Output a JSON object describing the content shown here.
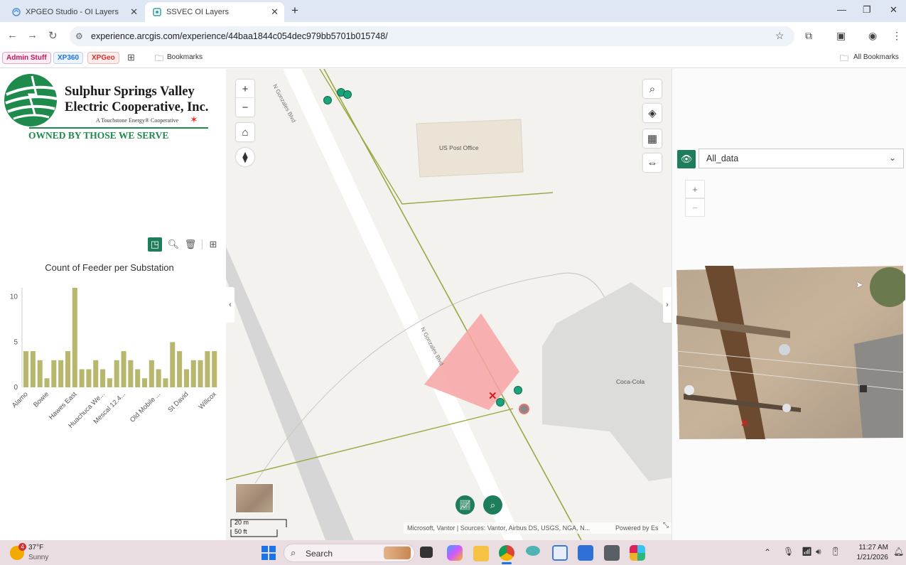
{
  "browser": {
    "tabs": [
      {
        "title": "XPGEO Studio - OI Layers",
        "active": false
      },
      {
        "title": "SSVEC OI Layers",
        "active": true
      }
    ],
    "new_tab": "+",
    "url": "experience.arcgis.com/experience/44baa1844c054dec979bb5701b015748/",
    "bookmarks": [
      {
        "label": "Admin Stuff",
        "color": "#c2185b"
      },
      {
        "label": "XP360",
        "color": "#1a73e8"
      },
      {
        "label": "XPGeo",
        "color": "#d93025"
      }
    ],
    "bookmarks_folder": "Bookmarks",
    "all_bookmarks": "All Bookmarks"
  },
  "logo": {
    "line1": "Sulphur Springs Valley",
    "line2": "Electric Cooperative, Inc.",
    "tagline": "A Touchstone Energy® Cooperative",
    "motto": "OWNED BY THOSE WE SERVE"
  },
  "chart_data": {
    "type": "bar",
    "title": "Count of Feeder per Substation",
    "categories": [
      "Alamo",
      "",
      "",
      "Bowie",
      "",
      "",
      "",
      "Hawes East",
      "",
      "",
      "",
      "Huachuca We...",
      "",
      "",
      "Mescal 12.4...",
      "",
      "",
      "",
      "",
      "Old Mobile ...",
      "",
      "",
      "",
      "St David",
      "",
      "",
      "",
      "Willcox"
    ],
    "values": [
      4,
      4,
      3,
      1,
      3,
      3,
      4,
      11,
      2,
      2,
      3,
      2,
      1,
      3,
      4,
      3,
      2,
      1,
      3,
      2,
      1,
      5,
      4,
      2,
      3,
      3,
      4,
      4
    ],
    "ylim": [
      0,
      11
    ],
    "yticks": [
      0,
      5,
      10
    ],
    "xtick_labels": [
      "Alamo",
      "Bowie",
      "Hawes East",
      "Huachuca We...",
      "Mescal 12.4...",
      "Old Mobile ...",
      "St David",
      "Willcox"
    ],
    "bar_color": "#b7b86e",
    "grid": false
  },
  "map": {
    "labels": {
      "post_office": "US Post Office",
      "street1": "N Gonzales Blvd",
      "street2": "N Gonzales Blvd",
      "cocacola": "Coca-Cola"
    },
    "scale_m": "20 m",
    "scale_ft": "50 ft",
    "attribution": "Microsoft, Vantor | Sources: Vantor, Airbus DS, USGS, NGA, N...",
    "powered_by": "Powered by Es",
    "controls": {
      "zoom_in": "+",
      "zoom_out": "−"
    }
  },
  "right_panel": {
    "layer_select": "All_data",
    "zoom_in": "+",
    "zoom_out": "−"
  },
  "taskbar": {
    "weather_temp": "37°F",
    "weather_desc": "Sunny",
    "weather_badge": "4",
    "search_placeholder": "Search",
    "time": "11:27 AM",
    "date": "1/21/2026"
  }
}
